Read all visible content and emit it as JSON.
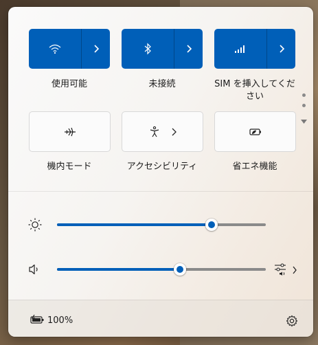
{
  "tiles": [
    {
      "label": "使用可能",
      "icon": "wifi-icon",
      "active": true
    },
    {
      "label": "未接続",
      "icon": "bluetooth-icon",
      "active": true
    },
    {
      "label": "SIM を挿入してください",
      "icon": "cellular-icon",
      "active": true
    },
    {
      "label": "機内モード",
      "icon": "airplane-icon",
      "active": false
    },
    {
      "label": "アクセシビリティ",
      "icon": "accessibility-icon",
      "active": false
    },
    {
      "label": "省エネ機能",
      "icon": "energy-saver-icon",
      "active": false
    }
  ],
  "brightness": {
    "icon": "brightness-icon",
    "level": 0.74
  },
  "volume": {
    "icon": "speaker-icon",
    "level": 0.59,
    "output_icon": "audio-output-icon"
  },
  "battery": {
    "icon": "battery-charging-icon",
    "text": "100%"
  },
  "settings": {
    "icon": "gear-icon"
  },
  "colors": {
    "accent": "#005fb8",
    "track": "#8a8a8a"
  }
}
